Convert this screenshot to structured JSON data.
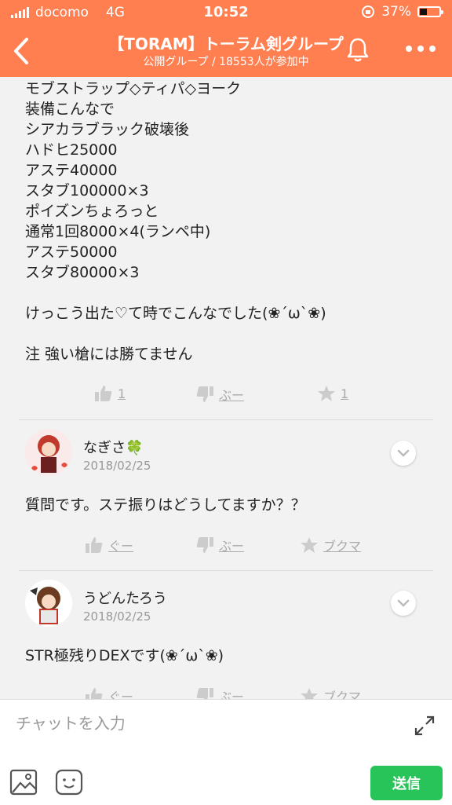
{
  "status": {
    "carrier": "docomo",
    "network": "4G",
    "time": "10:52",
    "battery_pct": "37%",
    "battery_level": 0.37
  },
  "header": {
    "title": "【TORAM】トーラム剣グループ",
    "subtitle": "公開グループ / 18553人が参加中"
  },
  "post": {
    "text": "モブストラップ◇ティパ◇ヨーク\n装備こんなで\nシアカラブラック破壊後\nハドヒ25000\nアステ40000\nスタブ100000×3\nポイズンちょろっと\n通常1回8000×4(ランペ中)\nアステ50000\nスタブ80000×3\n\nけっこう出た♡て時でこんなでした(❀´ω`❀)\n\n注 強い槍には勝てません",
    "like": "1",
    "dislike": "ぶー",
    "star": "1"
  },
  "comments": [
    {
      "name": "なぎさ🍀",
      "date": "2018/02/25",
      "text": "質問です。ステ振りはどうしてますか？？",
      "like": "ぐー",
      "dislike": "ぶー",
      "star": "ブクマ"
    },
    {
      "name": "うどんたろう",
      "date": "2018/02/25",
      "text": "STR極残りDEXです(❀´ω`❀)",
      "like": "ぐー",
      "dislike": "ぶー",
      "star": "ブクマ"
    }
  ],
  "input": {
    "placeholder": "チャットを入力",
    "send": "送信"
  },
  "colors": {
    "accent": "#ff7f50",
    "send": "#28c45a"
  }
}
